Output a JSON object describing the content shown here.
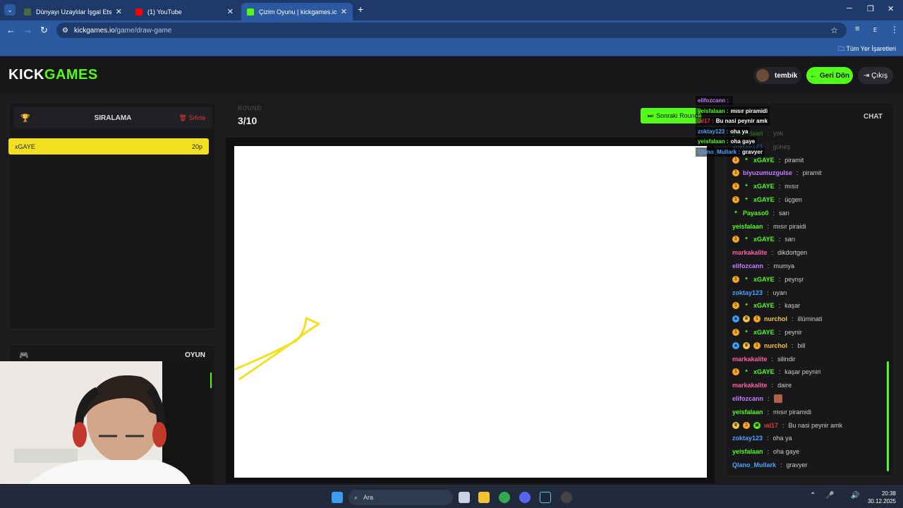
{
  "browser": {
    "tabs": [
      {
        "title": "Dünyayı Uzaylılar İşgal Etse İlk !",
        "fav": "#4a6a3a"
      },
      {
        "title": "(1) YouTube",
        "fav": "#ff0000"
      },
      {
        "title": "Çizim Oyunu | kickgames.io",
        "fav": "#53fc18"
      }
    ],
    "url_host": "kickgames.io",
    "url_path": "/game/draw-game",
    "bookmarks_label": "Tüm Yer İşaretleri",
    "profile_initial": "E"
  },
  "site": {
    "logo_left": "KICK",
    "logo_right": "GAMES",
    "username": "tembik",
    "back_label": "Geri Dön",
    "logout_label": "Çıkış"
  },
  "ranking": {
    "title": "SIRALAMA",
    "reset_label": "Sıfırla",
    "rows": [
      {
        "name": "xGAYE",
        "points": "20p"
      }
    ]
  },
  "game": {
    "title": "OYUN",
    "round_label": "ROUND",
    "round_value": "3/10",
    "next_round_label": "Sonraki Round"
  },
  "chat": {
    "title": "CHAT",
    "messages": [
      {
        "user": "yeisfalaan",
        "color": "#53fc18",
        "text": "yok",
        "badges": []
      },
      {
        "user": "zoktay123",
        "color": "#4ba3ff",
        "text": "güneş",
        "badges": []
      },
      {
        "user": "xGAYE",
        "color": "#53fc18",
        "text": "piramit",
        "badges": [
          "coin",
          "star"
        ]
      },
      {
        "user": "biyuzumuzgulse",
        "color": "#c77dff",
        "text": "piramit",
        "badges": [
          "coin"
        ]
      },
      {
        "user": "xGAYE",
        "color": "#53fc18",
        "text": "mısır",
        "badges": [
          "coin",
          "star"
        ]
      },
      {
        "user": "xGAYE",
        "color": "#53fc18",
        "text": "üçgen",
        "badges": [
          "coin",
          "star"
        ]
      },
      {
        "user": "Payaso0",
        "color": "#53fc18",
        "text": "sarı",
        "badges": [
          "star"
        ]
      },
      {
        "user": "yeisfalaan",
        "color": "#53fc18",
        "text": "mısır piraidi",
        "badges": []
      },
      {
        "user": "xGAYE",
        "color": "#53fc18",
        "text": "sarı",
        "badges": [
          "coin",
          "star"
        ]
      },
      {
        "user": "markakalite",
        "color": "#ff5fa2",
        "text": "dikdortgen",
        "badges": []
      },
      {
        "user": "elifozcann",
        "color": "#c77dff",
        "text": "mumya",
        "badges": []
      },
      {
        "user": "xGAYE",
        "color": "#53fc18",
        "text": "peynşr",
        "badges": [
          "coin",
          "star"
        ]
      },
      {
        "user": "zoktay123",
        "color": "#4ba3ff",
        "text": "uyarı",
        "badges": []
      },
      {
        "user": "xGAYE",
        "color": "#53fc18",
        "text": "kaşar",
        "badges": [
          "coin",
          "star"
        ]
      },
      {
        "user": "nurchol",
        "color": "#f5c542",
        "text": "illüminati",
        "badges": [
          "blue",
          "gold",
          "coin"
        ]
      },
      {
        "user": "xGAYE",
        "color": "#53fc18",
        "text": "peynir",
        "badges": [
          "coin",
          "star"
        ]
      },
      {
        "user": "nurchol",
        "color": "#f5c542",
        "text": "bill",
        "badges": [
          "blue",
          "gold",
          "coin"
        ]
      },
      {
        "user": "markakalite",
        "color": "#ff5fa2",
        "text": "silindir",
        "badges": []
      },
      {
        "user": "xGAYE",
        "color": "#53fc18",
        "text": "kaşar peyniri",
        "badges": [
          "coin",
          "star"
        ]
      },
      {
        "user": "markakalite",
        "color": "#ff5fa2",
        "text": "daire",
        "badges": []
      },
      {
        "user": "elifozcann",
        "color": "#c77dff",
        "text": "",
        "badges": [
          "emote"
        ]
      },
      {
        "user": "yeisfalaan",
        "color": "#53fc18",
        "text": "mısır piramidi",
        "badges": []
      },
      {
        "user": "ıal17",
        "color": "#e03b3b",
        "text": "Bu nasi peynir amk",
        "badges": [
          "gold",
          "coin",
          "gift"
        ]
      },
      {
        "user": "zoktay123",
        "color": "#4ba3ff",
        "text": "oha ya",
        "badges": []
      },
      {
        "user": "yeisfalaan",
        "color": "#53fc18",
        "text": "oha gaye",
        "badges": []
      },
      {
        "user": "Qlano_Mullark",
        "color": "#4ba3ff",
        "text": "gravyer",
        "badges": []
      }
    ]
  },
  "overlay": [
    {
      "user": "elifozcann",
      "color": "#c77dff",
      "text": ""
    },
    {
      "user": "yeisfalaan",
      "color": "#53fc18",
      "text": "mısır piramidi"
    },
    {
      "user": "ıal17",
      "color": "#e03b3b",
      "text": "Bu nasi peynir amk"
    },
    {
      "user": "zoktay123",
      "color": "#4ba3ff",
      "text": "oha ya"
    },
    {
      "user": "yeisfalaan",
      "color": "#53fc18",
      "text": "oha gaye"
    },
    {
      "user": "Qlano_Mullark",
      "color": "#4ba3ff",
      "text": "gravyer"
    }
  ],
  "taskbar": {
    "search_placeholder": "Ara",
    "time": "20:38",
    "date": "30.12.2025"
  },
  "colors": {
    "accent": "#53fc18",
    "stroke": "#f4e023"
  }
}
